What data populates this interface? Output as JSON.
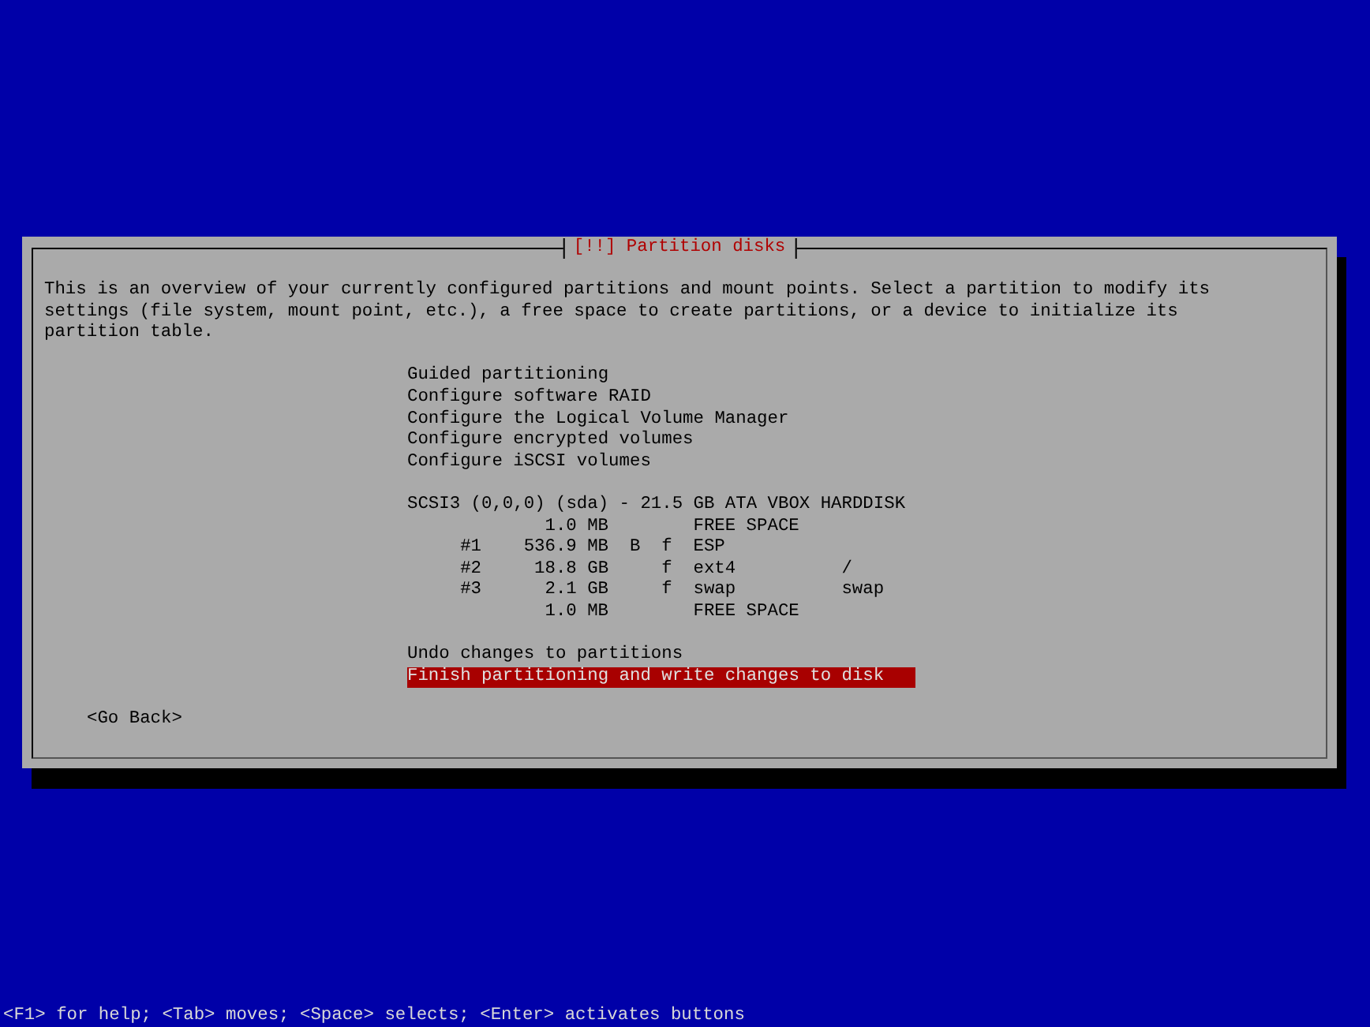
{
  "dialog": {
    "title": "[!!] Partition disks",
    "description": "This is an overview of your currently configured partitions and mount points. Select a partition to modify its settings (file system, mount point, etc.), a free space to create partitions, or a device to initialize its partition table.",
    "options": [
      {
        "label": "Guided partitioning",
        "selected": false
      },
      {
        "label": "Configure software RAID",
        "selected": false
      },
      {
        "label": "Configure the Logical Volume Manager",
        "selected": false
      },
      {
        "label": "Configure encrypted volumes",
        "selected": false
      },
      {
        "label": "Configure iSCSI volumes",
        "selected": false
      }
    ],
    "disk": {
      "label": "SCSI3 (0,0,0) (sda) - 21.5 GB ATA VBOX HARDDISK",
      "selected": false
    },
    "partitions": [
      {
        "size": "1.0 MB",
        "filesystem": "FREE SPACE",
        "selected": false
      },
      {
        "number": "#1",
        "size": "536.9 MB",
        "boot_flag": "B",
        "format_flag": "f",
        "filesystem": "ESP",
        "selected": false
      },
      {
        "number": "#2",
        "size": "18.8 GB",
        "format_flag": "f",
        "filesystem": "ext4",
        "mount_point": "/",
        "selected": false
      },
      {
        "number": "#3",
        "size": "2.1 GB",
        "format_flag": "f",
        "filesystem": "swap",
        "mount_point": "swap",
        "selected": false
      },
      {
        "size": "1.0 MB",
        "filesystem": "FREE SPACE",
        "selected": false
      }
    ],
    "actions": [
      {
        "label": "Undo changes to partitions",
        "selected": false
      },
      {
        "label": "Finish partitioning and write changes to disk",
        "selected": true
      }
    ],
    "back_button": "<Go Back>"
  },
  "status_bar": "<F1> for help; <Tab> moves; <Space> selects; <Enter> activates buttons"
}
